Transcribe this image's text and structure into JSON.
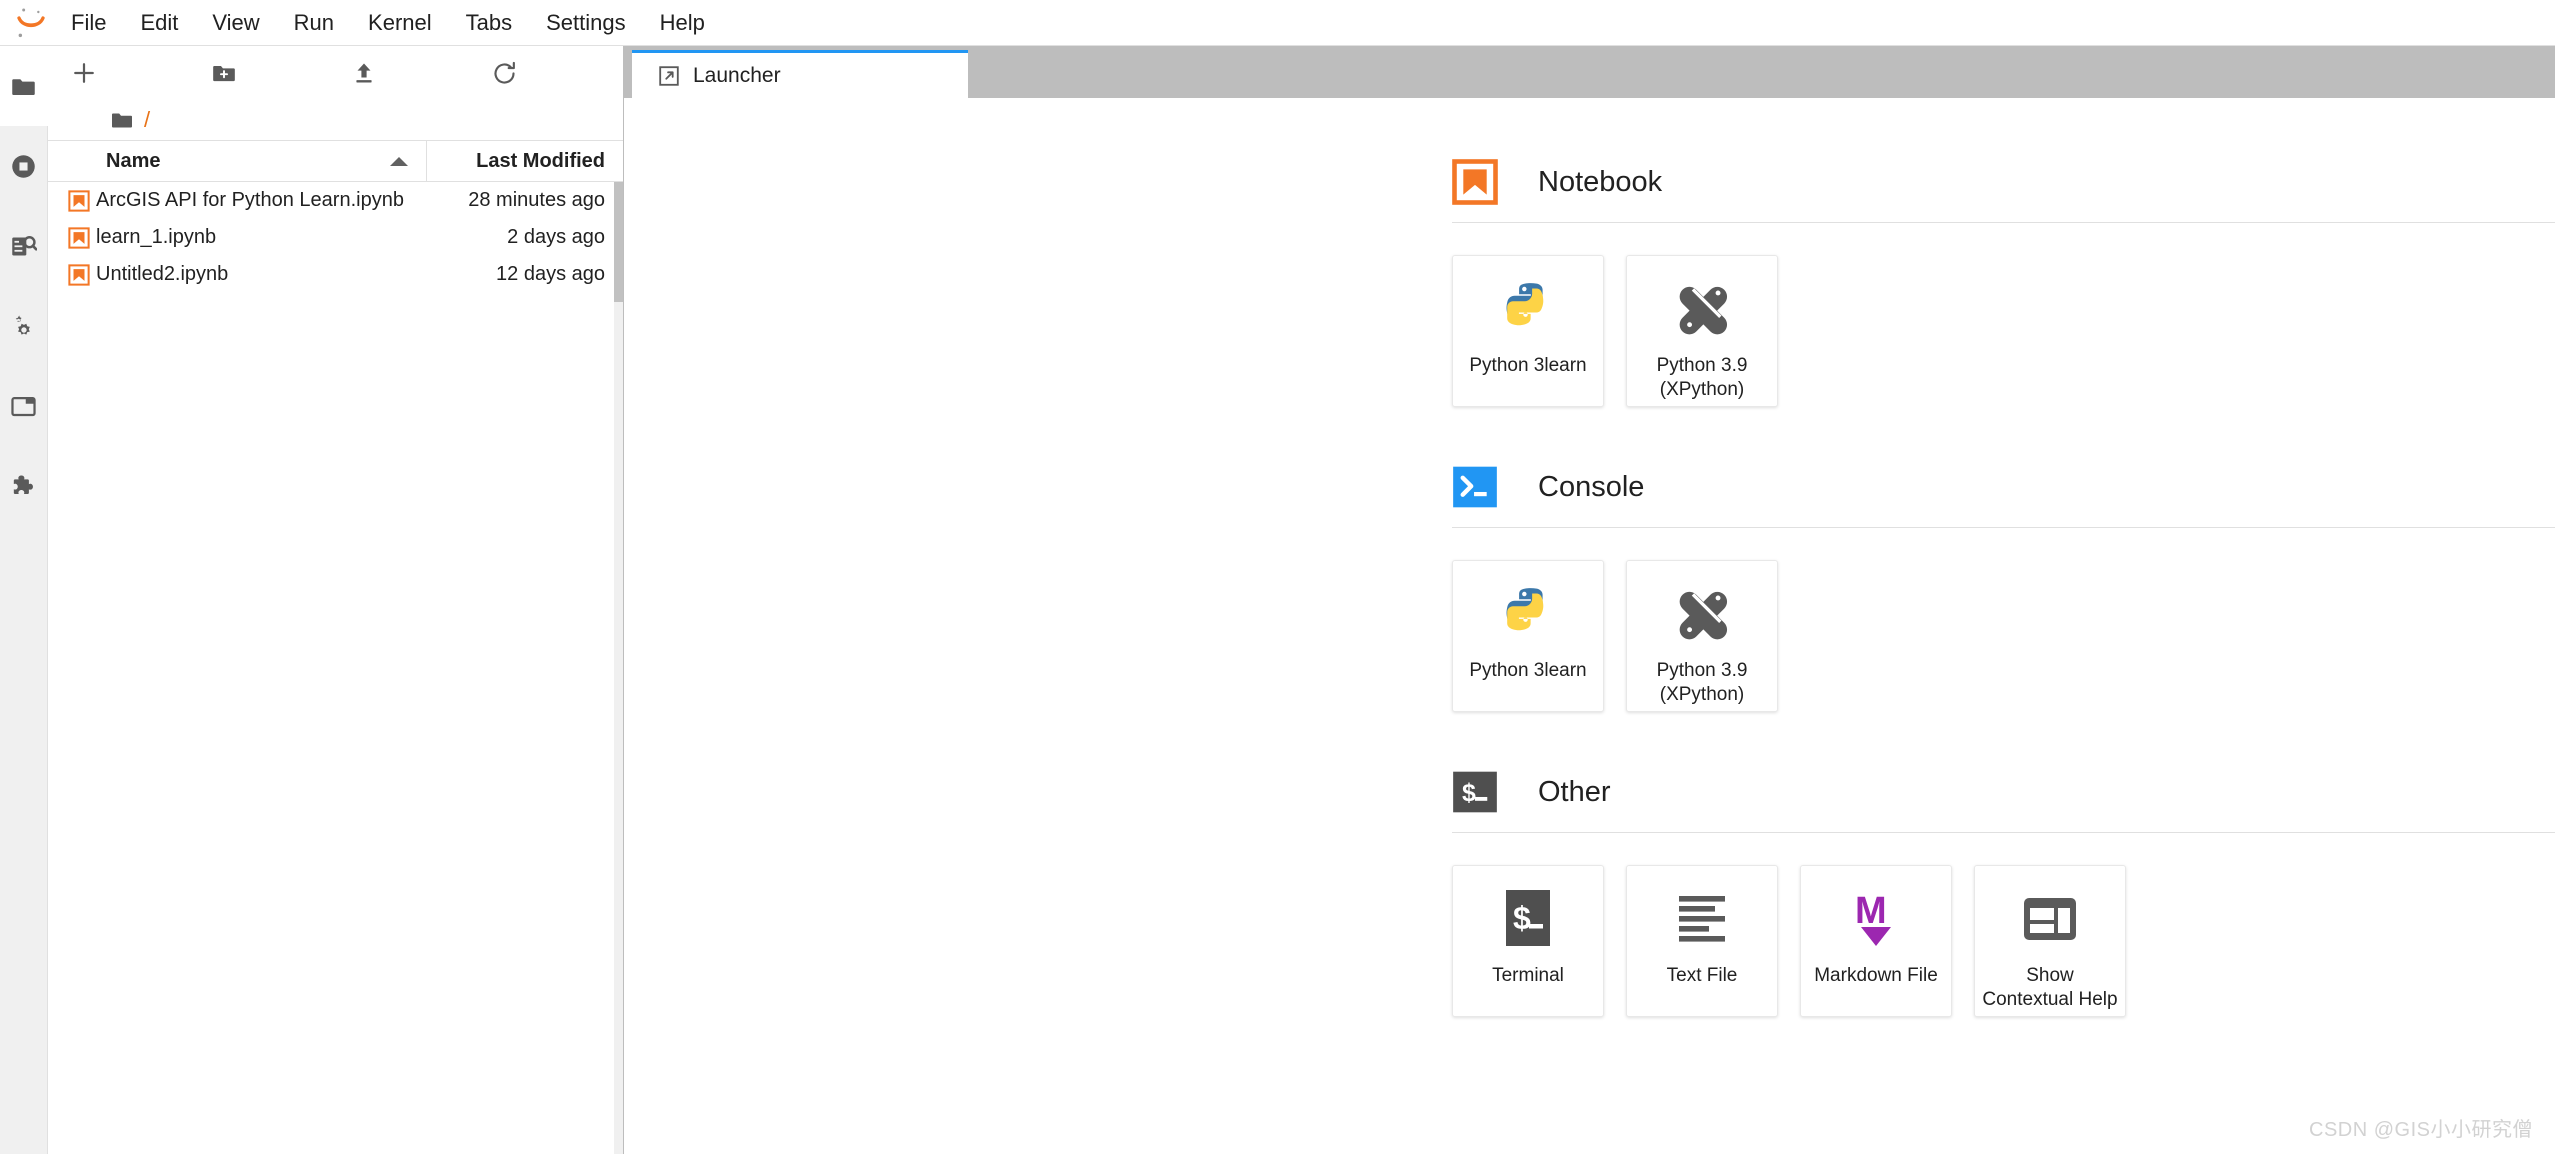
{
  "app": {
    "logo_icon": "jupyter-logo-icon",
    "watermark": "CSDN @GIS小小研究僧"
  },
  "menubar": {
    "items": [
      {
        "label": "File",
        "name": "menu-file"
      },
      {
        "label": "Edit",
        "name": "menu-edit"
      },
      {
        "label": "View",
        "name": "menu-view"
      },
      {
        "label": "Run",
        "name": "menu-run"
      },
      {
        "label": "Kernel",
        "name": "menu-kernel"
      },
      {
        "label": "Tabs",
        "name": "menu-tabs"
      },
      {
        "label": "Settings",
        "name": "menu-settings"
      },
      {
        "label": "Help",
        "name": "menu-help"
      }
    ]
  },
  "activity_bar": {
    "items": [
      {
        "icon": "folder-icon",
        "name": "sidebar-item-file-browser",
        "selected": true
      },
      {
        "icon": "stop-circle-icon",
        "name": "sidebar-item-running-terminals",
        "selected": false
      },
      {
        "icon": "table-of-contents-search-icon",
        "name": "sidebar-item-commands",
        "selected": false
      },
      {
        "icon": "gears-icon",
        "name": "sidebar-item-property-inspector",
        "selected": false
      },
      {
        "icon": "tab-window-icon",
        "name": "sidebar-item-open-tabs",
        "selected": false
      },
      {
        "icon": "puzzle-piece-icon",
        "name": "sidebar-item-extension-manager",
        "selected": false
      }
    ]
  },
  "file_browser": {
    "toolbar": [
      {
        "icon": "new-launcher-plus-icon",
        "name": "new-launcher-button",
        "title": "New Launcher"
      },
      {
        "icon": "new-folder-icon",
        "name": "new-folder-button",
        "title": "New Folder"
      },
      {
        "icon": "upload-icon",
        "name": "upload-files-button",
        "title": "Upload Files"
      },
      {
        "icon": "refresh-icon",
        "name": "refresh-file-list-button",
        "title": "Refresh File List"
      }
    ],
    "breadcrumb": {
      "home_icon": "folder-icon",
      "path": "/"
    },
    "columns": {
      "name": "Name",
      "last_modified": "Last Modified",
      "sort_direction": "ascending"
    },
    "files": [
      {
        "icon": "notebook-icon",
        "name": "ArcGIS API for Python Learn.ipynb",
        "modified": "28 minutes ago"
      },
      {
        "icon": "notebook-icon",
        "name": "learn_1.ipynb",
        "modified": "2 days ago"
      },
      {
        "icon": "notebook-icon",
        "name": "Untitled2.ipynb",
        "modified": "12 days ago"
      }
    ]
  },
  "tabs": [
    {
      "label": "Launcher",
      "icon": "launcher-icon",
      "name": "tab-launcher",
      "active": true
    }
  ],
  "launcher": {
    "sections": [
      {
        "title": "Notebook",
        "icon": "notebook-icon",
        "icon_color": "#f37726",
        "name": "launcher-section-notebook",
        "cards": [
          {
            "label": "Python 3learn",
            "icon": "python-icon",
            "name": "launcher-card-python-3learn"
          },
          {
            "label": "Python 3.9 (XPython)",
            "icon": "xpython-icon",
            "name": "launcher-card-python-39-xpython"
          }
        ]
      },
      {
        "title": "Console",
        "icon": "console-icon",
        "icon_color": "#2196f3",
        "name": "launcher-section-console",
        "cards": [
          {
            "label": "Python 3learn",
            "icon": "python-icon",
            "name": "launcher-card-console-python-3learn"
          },
          {
            "label": "Python 3.9 (XPython)",
            "icon": "xpython-icon",
            "name": "launcher-card-console-python-39-xpython"
          }
        ]
      },
      {
        "title": "Other",
        "icon": "terminal-icon",
        "icon_color": "#4f4f4f",
        "name": "launcher-section-other",
        "cards": [
          {
            "label": "Terminal",
            "icon": "terminal-icon",
            "name": "launcher-card-terminal"
          },
          {
            "label": "Text File",
            "icon": "text-file-icon",
            "name": "launcher-card-text-file"
          },
          {
            "label": "Markdown File",
            "icon": "markdown-icon",
            "name": "launcher-card-markdown-file"
          },
          {
            "label": "Show Contextual Help",
            "icon": "contextual-help-icon",
            "name": "launcher-card-contextual-help"
          }
        ]
      }
    ]
  }
}
